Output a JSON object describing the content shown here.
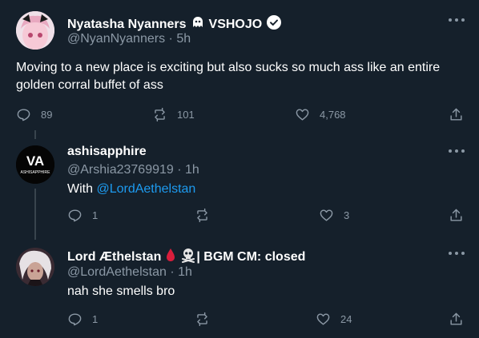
{
  "colors": {
    "background": "#15202b",
    "text": "#ffffff",
    "muted": "#8b98a5",
    "link": "#1d9bf0",
    "divider": "#38444d"
  },
  "main_tweet": {
    "display_name": "Nyatasha Nyanners",
    "name_suffix": "VSHOJO",
    "handle": "@NyanNyanners",
    "time": "5h",
    "text": "Moving to a new place is exciting but also sucks so much ass like an entire golden corral buffet of ass",
    "replies": "89",
    "retweets": "101",
    "likes": "4,768"
  },
  "reply1": {
    "display_name": "ashisapphire",
    "avatar_text": "ASHISAPPHIRE",
    "handle": "@Arshia23769919",
    "time": "1h",
    "text_prefix": "With ",
    "mention": "@LordAethelstan",
    "replies": "1",
    "retweets": "",
    "likes": "3"
  },
  "reply2": {
    "display_name": "Lord Æthelstan",
    "name_suffix": "| BGM CM: closed",
    "handle": "@LordAethelstan",
    "time": "1h",
    "text": "nah she smells bro",
    "replies": "1",
    "retweets": "",
    "likes": "24"
  },
  "icons": [
    "ghost-emoji-icon",
    "verified-badge-icon",
    "more-icon",
    "reply-icon",
    "retweet-icon",
    "like-icon",
    "share-icon",
    "blood-drop-icon",
    "skull-crossbones-icon"
  ]
}
